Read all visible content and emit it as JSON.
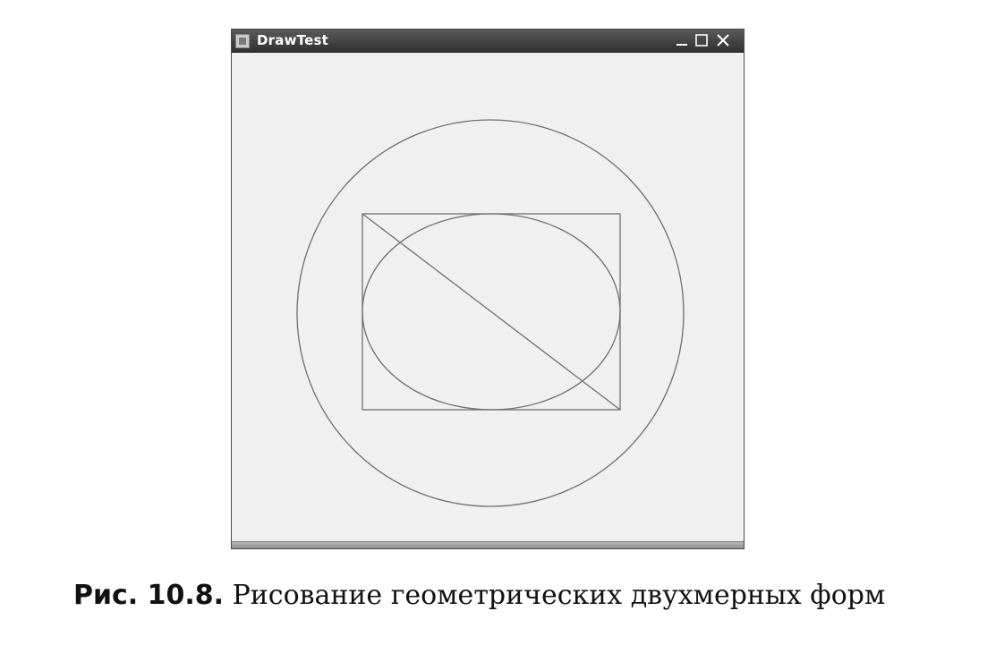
{
  "window": {
    "title": "DrawTest",
    "controls": {
      "minimize": "minimize",
      "maximize": "maximize",
      "close": "close"
    }
  },
  "figure": {
    "caption_number": "Рис. 10.8.",
    "caption_text": "Рисование геометрических двухмерных форм"
  },
  "colors": {
    "title_bar": "#3a3a3a",
    "canvas": "#f0f0f0",
    "shape_stroke": "#6f6f6f"
  }
}
